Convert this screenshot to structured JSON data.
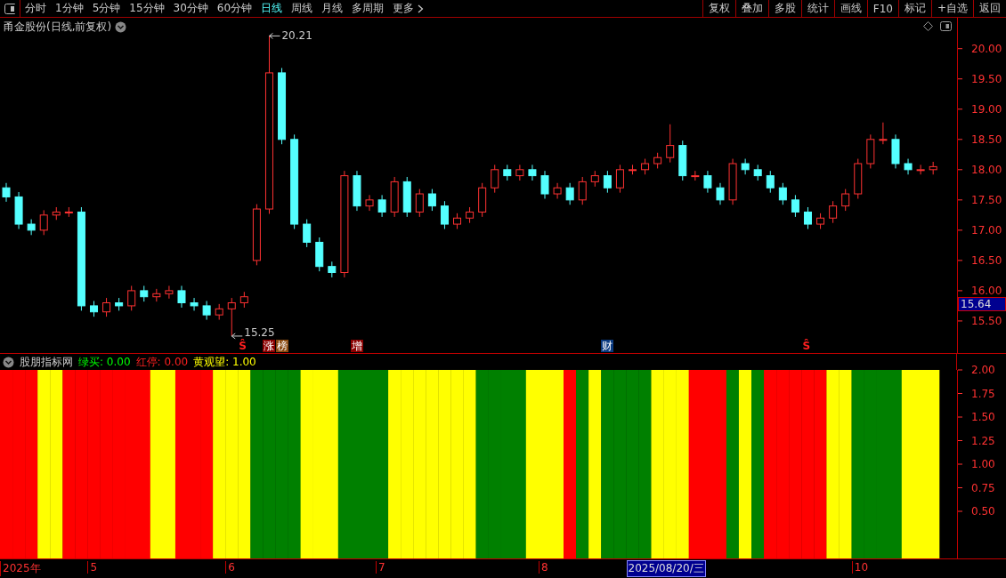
{
  "toolbar": {
    "periods": [
      {
        "label": "分时",
        "selected": false
      },
      {
        "label": "1分钟",
        "selected": false
      },
      {
        "label": "5分钟",
        "selected": false
      },
      {
        "label": "15分钟",
        "selected": false
      },
      {
        "label": "30分钟",
        "selected": false
      },
      {
        "label": "60分钟",
        "selected": false
      },
      {
        "label": "日线",
        "selected": true
      },
      {
        "label": "周线",
        "selected": false
      },
      {
        "label": "月线",
        "selected": false
      },
      {
        "label": "多周期",
        "selected": false
      }
    ],
    "more": "更多",
    "buttons": [
      "复权",
      "叠加",
      "多股",
      "统计",
      "画线",
      "F10",
      "标记",
      "+自选",
      "返回"
    ]
  },
  "chart": {
    "title": "甬金股份(日线,前复权)",
    "chart_data": {
      "type": "candlestick",
      "ylim": [
        14.97,
        20.51
      ],
      "yticks": [
        {
          "value": 20,
          "label": "20.00"
        },
        {
          "value": 19.5,
          "label": "19.50"
        },
        {
          "value": 19,
          "label": "19.00"
        },
        {
          "value": 18.5,
          "label": "18.50"
        },
        {
          "value": 18,
          "label": "18.00"
        },
        {
          "value": 17.5,
          "label": "17.50"
        },
        {
          "value": 17,
          "label": "17.00"
        },
        {
          "value": 16.5,
          "label": "16.50"
        },
        {
          "value": 16,
          "label": "16.00"
        },
        {
          "value": 15.5,
          "label": "15.50"
        }
      ],
      "categories": [
        null,
        null,
        null,
        null,
        null,
        null,
        null,
        null,
        null,
        null,
        null,
        null,
        null,
        null,
        null,
        null,
        null,
        null,
        null,
        null,
        null,
        null,
        null,
        null,
        null,
        null,
        null,
        null,
        null,
        null,
        null,
        null,
        null,
        null,
        null,
        null,
        null,
        null,
        null,
        null,
        null,
        null,
        null,
        null,
        null,
        null,
        null,
        null,
        null,
        null,
        null,
        null,
        null,
        null,
        null,
        null,
        null,
        null,
        null,
        null,
        null,
        null,
        null,
        null,
        null,
        null,
        null,
        null,
        null,
        null,
        null,
        null,
        null,
        null,
        null
      ],
      "ohlc": [
        [
          17.7,
          17.78,
          17.47,
          17.55
        ],
        [
          17.55,
          17.63,
          17.02,
          17.1
        ],
        [
          17.1,
          17.18,
          16.92,
          17.0
        ],
        [
          17.0,
          17.33,
          16.92,
          17.25
        ],
        [
          17.25,
          17.38,
          17.17,
          17.3
        ],
        [
          17.3,
          17.38,
          17.22,
          17.3
        ],
        [
          17.3,
          17.38,
          15.67,
          15.75
        ],
        [
          15.75,
          15.83,
          15.57,
          15.65
        ],
        [
          15.65,
          15.88,
          15.57,
          15.8
        ],
        [
          15.8,
          15.88,
          15.67,
          15.75
        ],
        [
          15.75,
          16.08,
          15.67,
          16.0
        ],
        [
          16.0,
          16.08,
          15.82,
          15.9
        ],
        [
          15.9,
          16.03,
          15.82,
          15.95
        ],
        [
          15.95,
          16.08,
          15.87,
          16.0
        ],
        [
          16.0,
          16.08,
          15.72,
          15.8
        ],
        [
          15.8,
          15.88,
          15.67,
          15.75
        ],
        [
          15.75,
          15.83,
          15.52,
          15.6
        ],
        [
          15.6,
          15.78,
          15.52,
          15.7
        ],
        [
          15.7,
          15.88,
          15.25,
          15.8
        ],
        [
          15.8,
          15.98,
          15.72,
          15.9
        ],
        [
          16.5,
          17.43,
          16.42,
          17.35
        ],
        [
          17.35,
          20.21,
          17.27,
          19.6
        ],
        [
          19.6,
          19.68,
          18.42,
          18.5
        ],
        [
          18.5,
          18.58,
          17.02,
          17.1
        ],
        [
          17.1,
          17.18,
          16.72,
          16.8
        ],
        [
          16.8,
          16.88,
          16.32,
          16.4
        ],
        [
          16.4,
          16.48,
          16.22,
          16.3
        ],
        [
          16.3,
          17.98,
          16.22,
          17.9
        ],
        [
          17.9,
          17.98,
          17.32,
          17.4
        ],
        [
          17.4,
          17.58,
          17.32,
          17.5
        ],
        [
          17.5,
          17.58,
          17.22,
          17.3
        ],
        [
          17.3,
          17.88,
          17.22,
          17.8
        ],
        [
          17.8,
          17.88,
          17.22,
          17.3
        ],
        [
          17.3,
          17.68,
          17.22,
          17.6
        ],
        [
          17.6,
          17.68,
          17.32,
          17.4
        ],
        [
          17.4,
          17.48,
          17.02,
          17.1
        ],
        [
          17.1,
          17.28,
          17.02,
          17.2
        ],
        [
          17.2,
          17.38,
          17.12,
          17.3
        ],
        [
          17.3,
          17.78,
          17.22,
          17.7
        ],
        [
          17.7,
          18.08,
          17.62,
          18.0
        ],
        [
          18.0,
          18.08,
          17.82,
          17.9
        ],
        [
          17.9,
          18.08,
          17.82,
          18.0
        ],
        [
          18.0,
          18.08,
          17.82,
          17.9
        ],
        [
          17.9,
          17.98,
          17.52,
          17.6
        ],
        [
          17.6,
          17.78,
          17.52,
          17.7
        ],
        [
          17.7,
          17.78,
          17.42,
          17.5
        ],
        [
          17.5,
          17.88,
          17.42,
          17.8
        ],
        [
          17.8,
          17.98,
          17.72,
          17.9
        ],
        [
          17.9,
          17.98,
          17.62,
          17.7
        ],
        [
          17.7,
          18.08,
          17.62,
          18.0
        ],
        [
          18.0,
          18.08,
          17.92,
          18.0
        ],
        [
          18.0,
          18.18,
          17.92,
          18.1
        ],
        [
          18.1,
          18.28,
          18.02,
          18.2
        ],
        [
          18.2,
          18.75,
          18.12,
          18.4
        ],
        [
          18.4,
          18.48,
          17.82,
          17.9
        ],
        [
          17.9,
          17.98,
          17.82,
          17.9
        ],
        [
          17.9,
          17.98,
          17.62,
          17.7
        ],
        [
          17.7,
          17.78,
          17.42,
          17.5
        ],
        [
          17.5,
          18.18,
          17.42,
          18.1
        ],
        [
          18.1,
          18.18,
          17.92,
          18.0
        ],
        [
          18.0,
          18.08,
          17.82,
          17.9
        ],
        [
          17.9,
          17.98,
          17.62,
          17.7
        ],
        [
          17.7,
          17.78,
          17.42,
          17.5
        ],
        [
          17.5,
          17.58,
          17.22,
          17.3
        ],
        [
          17.3,
          17.38,
          17.02,
          17.1
        ],
        [
          17.1,
          17.28,
          17.02,
          17.2
        ],
        [
          17.2,
          17.48,
          17.12,
          17.4
        ],
        [
          17.4,
          17.68,
          17.32,
          17.6
        ],
        [
          17.6,
          18.18,
          17.52,
          18.1
        ],
        [
          18.1,
          18.58,
          18.02,
          18.5
        ],
        [
          18.5,
          18.78,
          18.42,
          18.5
        ],
        [
          18.5,
          18.58,
          18.02,
          18.1
        ],
        [
          18.1,
          18.18,
          17.92,
          18.0
        ],
        [
          18.0,
          18.08,
          17.92,
          18.0
        ],
        [
          18.0,
          18.13,
          17.92,
          18.05
        ]
      ],
      "annotations": [
        "20.21",
        "15.25"
      ]
    },
    "price_tag": "15.64",
    "events": [
      {
        "kind": "symbol",
        "label": "Ŝ",
        "color": "#ff2020"
      },
      {
        "kind": "tag",
        "label": "涨",
        "color": "#8b0000"
      },
      {
        "kind": "tag",
        "label": "榜",
        "color": "#8b4a10"
      },
      {
        "kind": "tag",
        "label": "增",
        "color": "#8b0000"
      },
      {
        "kind": "tag",
        "label": "财",
        "color": "#0a3a80"
      },
      {
        "kind": "symbol",
        "label": "Ŝ",
        "color": "#ff2020"
      }
    ],
    "date_axis": {
      "labels": [
        "2025年",
        "5",
        "6",
        "7",
        "8",
        "10"
      ],
      "cursor": "2025/08/20/三"
    }
  },
  "indicator": {
    "title": "股朋指标网",
    "legend": [
      {
        "label": "绿买:",
        "value": "0.00",
        "color": "#00ff00"
      },
      {
        "label": "红停:",
        "value": "0.00",
        "color": "#ff2020"
      },
      {
        "label": "黄观望:",
        "value": "1.00",
        "color": "#ffff00"
      }
    ],
    "axis_labels": [
      "2.00",
      "1.75",
      "1.50",
      "1.25",
      "1.00",
      "0.75",
      "0.50"
    ],
    "signals": [
      {
        "color": "#ff0000"
      },
      {
        "color": "#ff0000"
      },
      {
        "color": "#ff0000"
      },
      {
        "color": "#ffff00"
      },
      {
        "color": "#ffff00"
      },
      {
        "color": "#ff0000"
      },
      {
        "color": "#ff0000"
      },
      {
        "color": "#ff0000"
      },
      {
        "color": "#ff0000"
      },
      {
        "color": "#ff0000"
      },
      {
        "color": "#ff0000"
      },
      {
        "color": "#ff0000"
      },
      {
        "color": "#ffff00"
      },
      {
        "color": "#ffff00"
      },
      {
        "color": "#ff0000"
      },
      {
        "color": "#ff0000"
      },
      {
        "color": "#ff0000"
      },
      {
        "color": "#ffff00"
      },
      {
        "color": "#ffff00"
      },
      {
        "color": "#ffff00"
      },
      {
        "color": "#008000"
      },
      {
        "color": "#008000"
      },
      {
        "color": "#008000"
      },
      {
        "color": "#008000"
      },
      {
        "color": "#ffff00"
      },
      {
        "color": "#ffff00"
      },
      {
        "color": "#ffff00"
      },
      {
        "color": "#008000"
      },
      {
        "color": "#008000"
      },
      {
        "color": "#008000"
      },
      {
        "color": "#008000"
      },
      {
        "color": "#ffff00"
      },
      {
        "color": "#ffff00"
      },
      {
        "color": "#ffff00"
      },
      {
        "color": "#ffff00"
      },
      {
        "color": "#ffff00"
      },
      {
        "color": "#ffff00"
      },
      {
        "color": "#ffff00"
      },
      {
        "color": "#008000"
      },
      {
        "color": "#008000"
      },
      {
        "color": "#008000"
      },
      {
        "color": "#008000"
      },
      {
        "color": "#ffff00"
      },
      {
        "color": "#ffff00"
      },
      {
        "color": "#ffff00"
      },
      {
        "color": "#ff0000"
      },
      {
        "color": "#008000"
      },
      {
        "color": "#ffff00"
      },
      {
        "color": "#008000"
      },
      {
        "color": "#008000"
      },
      {
        "color": "#008000"
      },
      {
        "color": "#008000"
      },
      {
        "color": "#ffff00"
      },
      {
        "color": "#ffff00"
      },
      {
        "color": "#ffff00"
      },
      {
        "color": "#ff0000"
      },
      {
        "color": "#ff0000"
      },
      {
        "color": "#ff0000"
      },
      {
        "color": "#008000"
      },
      {
        "color": "#ffff00"
      },
      {
        "color": "#008000"
      },
      {
        "color": "#ff0000"
      },
      {
        "color": "#ff0000"
      },
      {
        "color": "#ff0000"
      },
      {
        "color": "#ff0000"
      },
      {
        "color": "#ff0000"
      },
      {
        "color": "#ffff00"
      },
      {
        "color": "#ffff00"
      },
      {
        "color": "#008000"
      },
      {
        "color": "#008000"
      },
      {
        "color": "#008000"
      },
      {
        "color": "#008000"
      },
      {
        "color": "#ffff00"
      },
      {
        "color": "#ffff00"
      },
      {
        "color": "#ffff00"
      }
    ]
  }
}
